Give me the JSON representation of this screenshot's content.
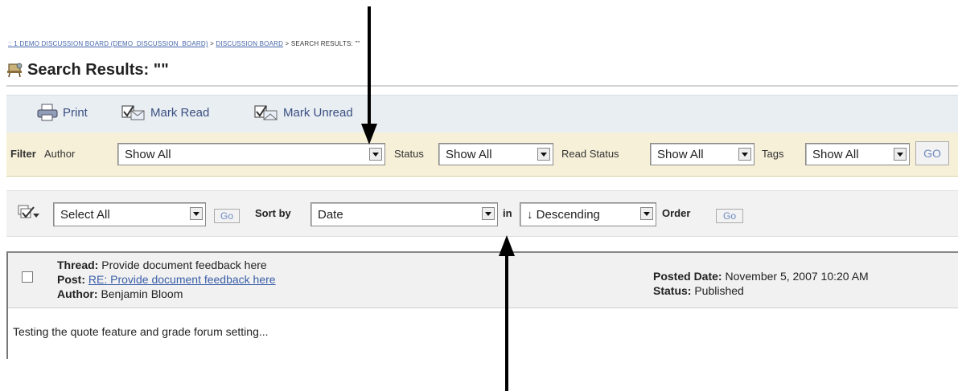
{
  "breadcrumb": {
    "link1": ":: 1 DEMO DISCUSSION BOARD (DEMO_DISCUSSION_BOARD)",
    "sep1": " > ",
    "link2": "DISCUSSION BOARD",
    "sep2": " > ",
    "current": "SEARCH RESULTS: \"\""
  },
  "page": {
    "title": "Search Results: \"\"",
    "title_icon": "discussion-board-icon"
  },
  "toolbar": {
    "print_label": "Print",
    "mark_read_label": "Mark Read",
    "mark_unread_label": "Mark Unread"
  },
  "filter": {
    "filter_label": "Filter",
    "author_label": "Author",
    "author_value": "Show All",
    "status_label": "Status",
    "status_value": "Show All",
    "read_status_label": "Read Status",
    "read_status_value": "Show All",
    "tags_label": "Tags",
    "tags_value": "Show All",
    "go_label": "GO"
  },
  "actions": {
    "select_value": "Select All",
    "go_label": "Go",
    "sort_by_label": "Sort by",
    "sort_value": "Date",
    "in_label": "in",
    "direction_value": "↓ Descending",
    "order_label": "Order",
    "order_go_label": "Go"
  },
  "result": {
    "thread_label": "Thread:",
    "thread_value": "Provide document feedback here",
    "post_label": "Post:",
    "post_value": "RE: Provide document feedback here",
    "author_label": "Author:",
    "author_value": "Benjamin Bloom",
    "posted_date_label": "Posted Date:",
    "posted_date_value": "November 5, 2007 10:20 AM",
    "status_label": "Status:",
    "status_value": "Published",
    "body": "Testing the quote feature and grade forum setting..."
  },
  "colors": {
    "link": "#3a5fa8",
    "filter_bg": "#f6f0d8",
    "toolbar_bg": "#e9eef3"
  }
}
